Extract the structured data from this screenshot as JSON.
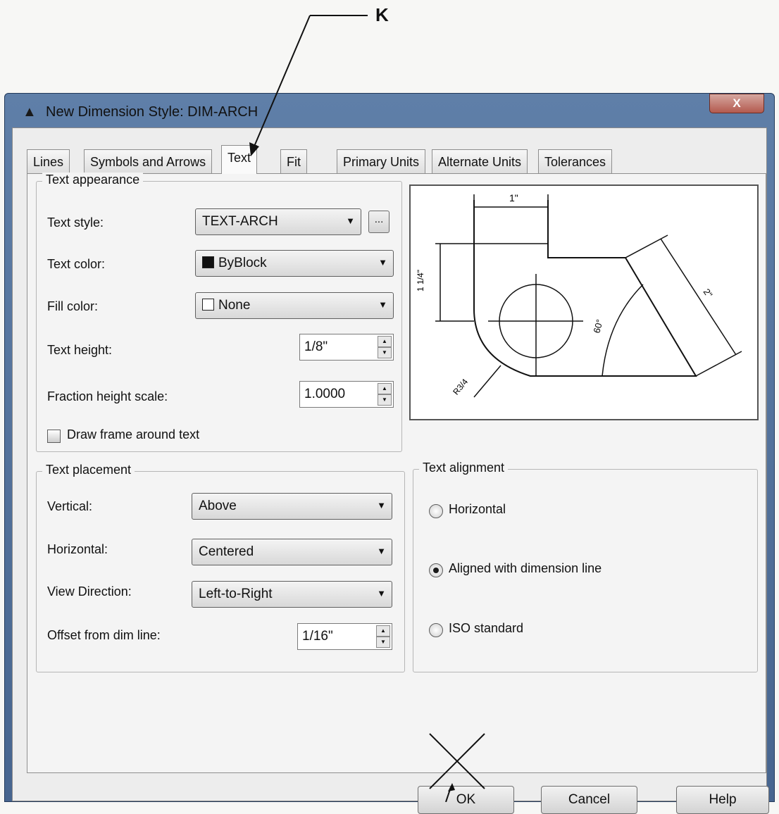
{
  "callout": {
    "letter": "K"
  },
  "window": {
    "title": "New Dimension Style: DIM-ARCH",
    "close_label": "X",
    "app_icon": "autocad-icon"
  },
  "tabs": [
    {
      "label": "Lines",
      "active": false
    },
    {
      "label": "Symbols and Arrows",
      "active": false
    },
    {
      "label": "Text",
      "active": true
    },
    {
      "label": "Fit",
      "active": false
    },
    {
      "label": "Primary Units",
      "active": false
    },
    {
      "label": "Alternate Units",
      "active": false
    },
    {
      "label": "Tolerances",
      "active": false
    }
  ],
  "text_appearance": {
    "legend": "Text appearance",
    "text_style_label": "Text style:",
    "text_style_value": "TEXT-ARCH",
    "text_style_browse": "...",
    "text_color_label": "Text color:",
    "text_color_value": "ByBlock",
    "fill_color_label": "Fill color:",
    "fill_color_value": "None",
    "text_height_label": "Text height:",
    "text_height_value": "1/8\"",
    "fraction_scale_label": "Fraction height scale:",
    "fraction_scale_value": "1.0000",
    "draw_frame_label": "Draw frame around text",
    "draw_frame_checked": false
  },
  "preview": {
    "dim_top": "1\"",
    "dim_left": "1 1/4\"",
    "dim_angle": "60°",
    "dim_diag": "2\"",
    "dim_radius": "R3/4"
  },
  "text_placement": {
    "legend": "Text placement",
    "vertical_label": "Vertical:",
    "vertical_value": "Above",
    "horizontal_label": "Horizontal:",
    "horizontal_value": "Centered",
    "view_direction_label": "View Direction:",
    "view_direction_value": "Left-to-Right",
    "offset_label": "Offset from dim line:",
    "offset_value": "1/16\""
  },
  "text_alignment": {
    "legend": "Text alignment",
    "options": [
      {
        "label": "Horizontal",
        "checked": false
      },
      {
        "label": "Aligned with dimension line",
        "checked": true
      },
      {
        "label": "ISO standard",
        "checked": false
      }
    ]
  },
  "buttons": {
    "ok": "OK",
    "cancel": "Cancel",
    "help": "Help"
  },
  "colors": {
    "titlebar": "#5f7fa8",
    "close": "#b35a4e",
    "dialog_bg": "#ededed"
  }
}
